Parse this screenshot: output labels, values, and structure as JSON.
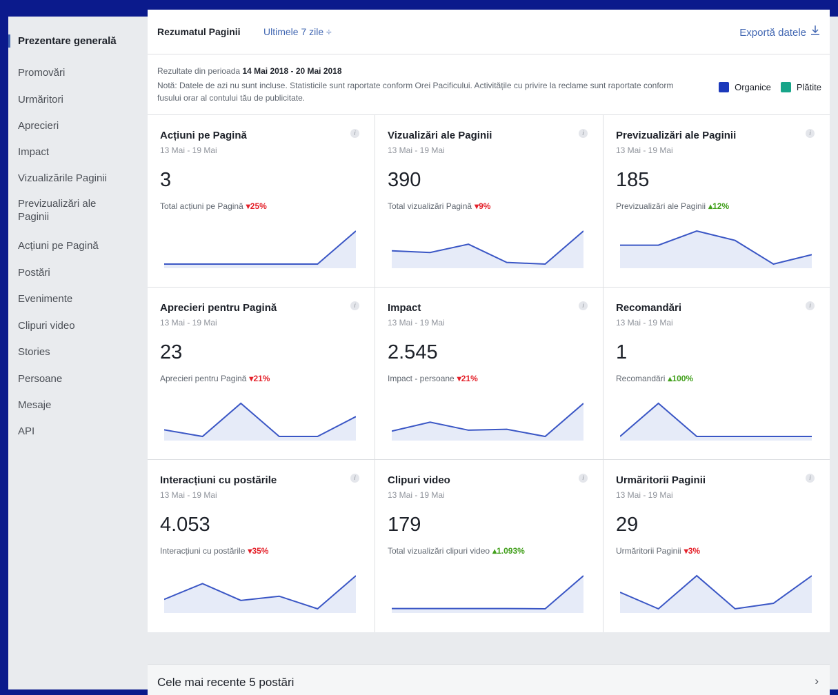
{
  "colors": {
    "organic": "#1c39bb",
    "paid": "#17a589",
    "line": "#3a56c5",
    "fill": "#e6ebf8"
  },
  "sidebar": {
    "items": [
      {
        "label": "Prezentare generală",
        "active": true
      },
      {
        "label": "Promovări"
      },
      {
        "label": "Urmăritori"
      },
      {
        "label": "Aprecieri"
      },
      {
        "label": "Impact"
      },
      {
        "label": "Vizualizările Paginii"
      },
      {
        "label": "Previzualizări ale Paginii"
      },
      {
        "label": "Acțiuni pe Pagină"
      },
      {
        "label": "Postări"
      },
      {
        "label": "Evenimente"
      },
      {
        "label": "Clipuri video"
      },
      {
        "label": "Stories"
      },
      {
        "label": "Persoane"
      },
      {
        "label": "Mesaje"
      },
      {
        "label": "API"
      }
    ]
  },
  "header": {
    "title": "Rezumatul Paginii",
    "range": "Ultimele 7 zile ÷",
    "export": "Exportă datele",
    "export_icon": "download-icon"
  },
  "notice": {
    "period_prefix": "Rezultate din perioada",
    "period": "14 Mai 2018 - 20 Mai 2018",
    "note": "Notă: Datele de azi nu sunt incluse. Statisticile sunt raportate conform Orei Pacificului. Activitățile cu privire la reclame sunt raportate conform fusului orar al contului tău de publicitate."
  },
  "legend": {
    "organic": "Organice",
    "paid": "Plătite"
  },
  "cards": [
    {
      "title": "Acțiuni pe Pagină",
      "date": "13 Mai - 19 Mai",
      "value": "3",
      "label": "Total acțiuni pe Pagină",
      "change": "25%",
      "dir": "down",
      "series": [
        1,
        1,
        1,
        1,
        1,
        2
      ]
    },
    {
      "title": "Vizualizări ale Paginii",
      "date": "13 Mai - 19 Mai",
      "value": "390",
      "label": "Total vizualizări Pagină",
      "change": "9%",
      "dir": "down",
      "series": [
        62,
        61,
        66,
        55,
        54,
        74
      ]
    },
    {
      "title": "Previzualizări ale Paginii",
      "date": "13 Mai - 19 Mai",
      "value": "185",
      "label": "Previzualizări ale Paginii",
      "change": "12%",
      "dir": "up",
      "series": [
        27,
        27,
        33,
        29,
        19,
        23
      ]
    },
    {
      "title": "Aprecieri pentru Pagină",
      "date": "13 Mai - 19 Mai",
      "value": "23",
      "label": "Aprecieri pentru Pagină",
      "change": "21%",
      "dir": "down",
      "series": [
        3,
        2,
        7,
        2,
        2,
        5
      ]
    },
    {
      "title": "Impact",
      "date": "13 Mai - 19 Mai",
      "value": "2.545",
      "label": "Impact - persoane",
      "change": "21%",
      "dir": "down",
      "series": [
        360,
        460,
        370,
        380,
        300,
        670
      ]
    },
    {
      "title": "Recomandări",
      "date": "13 Mai - 19 Mai",
      "value": "1",
      "label": "Recomandări",
      "change": "100%",
      "dir": "up",
      "series": [
        0,
        1,
        0,
        0,
        0,
        0
      ]
    },
    {
      "title": "Interacțiuni cu postările",
      "date": "13 Mai - 19 Mai",
      "value": "4.053",
      "label": "Interacțiuni cu postările",
      "change": "35%",
      "dir": "down",
      "series": [
        600,
        900,
        580,
        660,
        420,
        1050
      ]
    },
    {
      "title": "Clipuri video",
      "date": "13 Mai - 19 Mai",
      "value": "179",
      "label": "Total vizualizări clipuri video",
      "change": "1.093%",
      "dir": "up",
      "series": [
        2,
        2,
        2,
        2,
        1,
        120
      ]
    },
    {
      "title": "Urmăritorii Paginii",
      "date": "13 Mai - 19 Mai",
      "value": "29",
      "label": "Urmăritorii Paginii",
      "change": "3%",
      "dir": "down",
      "series": [
        5,
        2,
        8,
        2,
        3,
        8
      ]
    }
  ],
  "recent": {
    "label": "Cele mai recente 5 postări",
    "chevron": "chevron-right-icon"
  }
}
